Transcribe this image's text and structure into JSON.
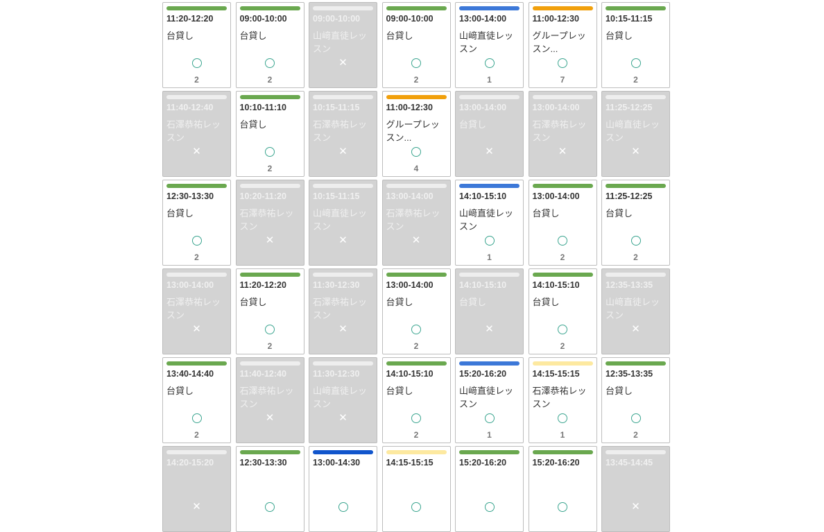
{
  "colors": {
    "green": "#6aa84f",
    "blue": "#3c78d8",
    "orange": "#f1a00c",
    "navy": "#1155cc",
    "yellow": "#fde9a0",
    "light": "#eeeeee",
    "available_mark": "#3aa58f"
  },
  "marks": {
    "available": "○",
    "unavailable": "✕"
  },
  "slots": [
    {
      "time": "11:20-12:20",
      "name": "台貸し",
      "status": "available",
      "count": "2",
      "color": "#6aa84f"
    },
    {
      "time": "09:00-10:00",
      "name": "台貸し",
      "status": "available",
      "count": "2",
      "color": "#6aa84f"
    },
    {
      "time": "09:00-10:00",
      "name": "山﨑直徒レッスン",
      "status": "unavailable",
      "count": "",
      "color": "#eeeeee"
    },
    {
      "time": "09:00-10:00",
      "name": "台貸し",
      "status": "available",
      "count": "2",
      "color": "#6aa84f"
    },
    {
      "time": "13:00-14:00",
      "name": "山﨑直徒レッスン",
      "status": "available",
      "count": "1",
      "color": "#3c78d8"
    },
    {
      "time": "11:00-12:30",
      "name": "グループレッスン...",
      "status": "available",
      "count": "7",
      "color": "#f1a00c"
    },
    {
      "time": "10:15-11:15",
      "name": "台貸し",
      "status": "available",
      "count": "2",
      "color": "#6aa84f"
    },
    {
      "time": "11:40-12:40",
      "name": "石澤恭祐レッスン",
      "status": "unavailable",
      "count": "",
      "color": "#eeeeee"
    },
    {
      "time": "10:10-11:10",
      "name": "台貸し",
      "status": "available",
      "count": "2",
      "color": "#6aa84f"
    },
    {
      "time": "10:15-11:15",
      "name": "石澤恭祐レッスン",
      "status": "unavailable",
      "count": "",
      "color": "#eeeeee"
    },
    {
      "time": "11:00-12:30",
      "name": "グループレッスン...",
      "status": "available",
      "count": "4",
      "color": "#f1a00c"
    },
    {
      "time": "13:00-14:00",
      "name": "台貸し",
      "status": "unavailable",
      "count": "",
      "color": "#eeeeee"
    },
    {
      "time": "13:00-14:00",
      "name": "石澤恭祐レッスン",
      "status": "unavailable",
      "count": "",
      "color": "#eeeeee"
    },
    {
      "time": "11:25-12:25",
      "name": "山﨑直徒レッスン",
      "status": "unavailable",
      "count": "",
      "color": "#eeeeee"
    },
    {
      "time": "12:30-13:30",
      "name": "台貸し",
      "status": "available",
      "count": "2",
      "color": "#6aa84f"
    },
    {
      "time": "10:20-11:20",
      "name": "石澤恭祐レッスン",
      "status": "unavailable",
      "count": "",
      "color": "#eeeeee"
    },
    {
      "time": "10:15-11:15",
      "name": "山﨑直徒レッスン",
      "status": "unavailable",
      "count": "",
      "color": "#eeeeee"
    },
    {
      "time": "13:00-14:00",
      "name": "石澤恭祐レッスン",
      "status": "unavailable",
      "count": "",
      "color": "#eeeeee"
    },
    {
      "time": "14:10-15:10",
      "name": "山﨑直徒レッスン",
      "status": "available",
      "count": "1",
      "color": "#3c78d8"
    },
    {
      "time": "13:00-14:00",
      "name": "台貸し",
      "status": "available",
      "count": "2",
      "color": "#6aa84f"
    },
    {
      "time": "11:25-12:25",
      "name": "台貸し",
      "status": "available",
      "count": "2",
      "color": "#6aa84f"
    },
    {
      "time": "13:00-14:00",
      "name": "石澤恭祐レッスン",
      "status": "unavailable",
      "count": "",
      "color": "#eeeeee"
    },
    {
      "time": "11:20-12:20",
      "name": "台貸し",
      "status": "available",
      "count": "2",
      "color": "#6aa84f"
    },
    {
      "time": "11:30-12:30",
      "name": "石澤恭祐レッスン",
      "status": "unavailable",
      "count": "",
      "color": "#eeeeee"
    },
    {
      "time": "13:00-14:00",
      "name": "台貸し",
      "status": "available",
      "count": "2",
      "color": "#6aa84f"
    },
    {
      "time": "14:10-15:10",
      "name": "台貸し",
      "status": "unavailable",
      "count": "",
      "color": "#eeeeee"
    },
    {
      "time": "14:10-15:10",
      "name": "台貸し",
      "status": "available",
      "count": "2",
      "color": "#6aa84f"
    },
    {
      "time": "12:35-13:35",
      "name": "山﨑直徒レッスン",
      "status": "unavailable",
      "count": "",
      "color": "#eeeeee"
    },
    {
      "time": "13:40-14:40",
      "name": "台貸し",
      "status": "available",
      "count": "2",
      "color": "#6aa84f"
    },
    {
      "time": "11:40-12:40",
      "name": "石澤恭祐レッスン",
      "status": "unavailable",
      "count": "",
      "color": "#eeeeee"
    },
    {
      "time": "11:30-12:30",
      "name": "山﨑直徒レッスン",
      "status": "unavailable",
      "count": "",
      "color": "#eeeeee"
    },
    {
      "time": "14:10-15:10",
      "name": "台貸し",
      "status": "available",
      "count": "2",
      "color": "#6aa84f"
    },
    {
      "time": "15:20-16:20",
      "name": "山﨑直徒レッスン",
      "status": "available",
      "count": "1",
      "color": "#3c78d8"
    },
    {
      "time": "14:15-15:15",
      "name": "石澤恭祐レッスン",
      "status": "available",
      "count": "1",
      "color": "#fde9a0"
    },
    {
      "time": "12:35-13:35",
      "name": "台貸し",
      "status": "available",
      "count": "2",
      "color": "#6aa84f"
    },
    {
      "time": "14:20-15:20",
      "name": "",
      "status": "unavailable",
      "count": "",
      "color": "#eeeeee"
    },
    {
      "time": "12:30-13:30",
      "name": "",
      "status": "available",
      "count": "",
      "color": "#6aa84f"
    },
    {
      "time": "13:00-14:30",
      "name": "",
      "status": "available",
      "count": "",
      "color": "#1155cc"
    },
    {
      "time": "14:15-15:15",
      "name": "",
      "status": "available",
      "count": "",
      "color": "#fde9a0"
    },
    {
      "time": "15:20-16:20",
      "name": "",
      "status": "available",
      "count": "",
      "color": "#6aa84f"
    },
    {
      "time": "15:20-16:20",
      "name": "",
      "status": "available",
      "count": "",
      "color": "#6aa84f"
    },
    {
      "time": "13:45-14:45",
      "name": "",
      "status": "unavailable",
      "count": "",
      "color": "#eeeeee"
    }
  ]
}
